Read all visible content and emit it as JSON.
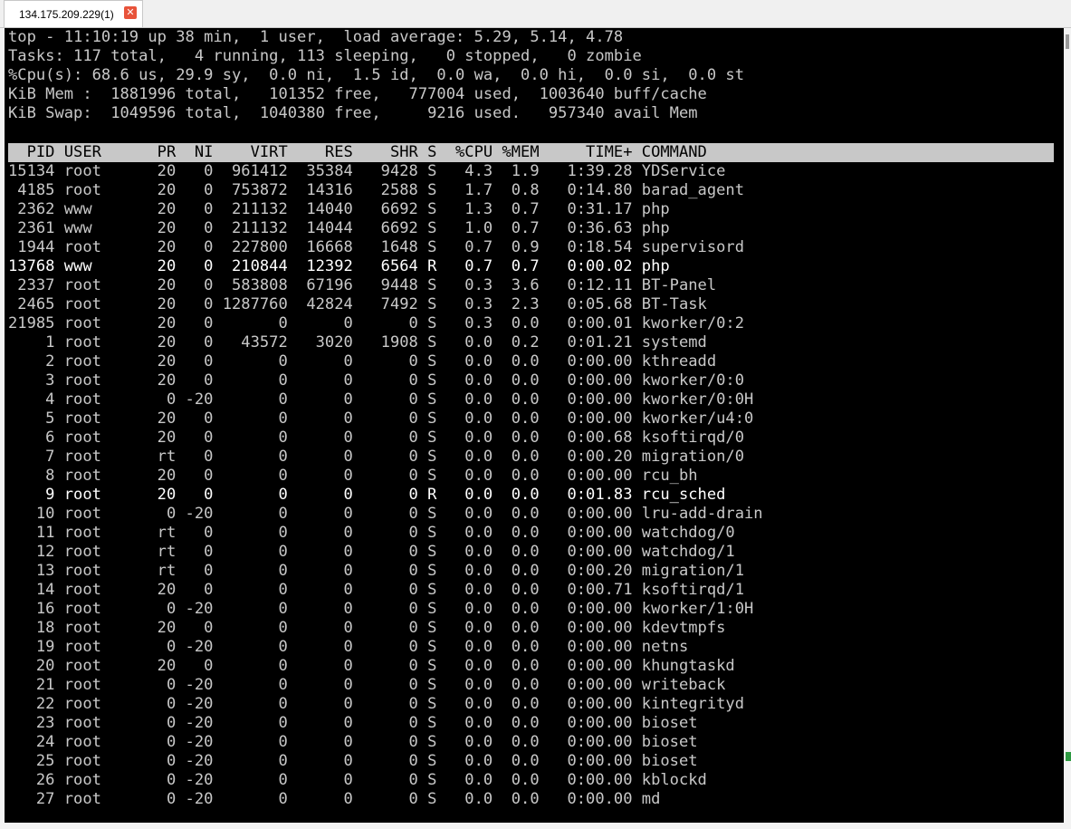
{
  "tab": {
    "title": "134.175.209.229(1)",
    "close_glyph": "✕"
  },
  "summary": [
    "top - 11:10:19 up 38 min,  1 user,  load average: 5.29, 5.14, 4.78",
    "Tasks: 117 total,   4 running, 113 sleeping,   0 stopped,   0 zombie",
    "%Cpu(s): 68.6 us, 29.9 sy,  0.0 ni,  1.5 id,  0.0 wa,  0.0 hi,  0.0 si,  0.0 st",
    "KiB Mem :  1881996 total,   101352 free,   777004 used,  1003640 buff/cache",
    "KiB Swap:  1049596 total,  1040380 free,     9216 used.   957340 avail Mem"
  ],
  "columns": [
    "PID",
    "USER",
    "PR",
    "NI",
    "VIRT",
    "RES",
    "SHR",
    "S",
    "%CPU",
    "%MEM",
    "TIME+",
    "COMMAND"
  ],
  "processes": [
    {
      "pid": "15134",
      "user": "root",
      "pr": "20",
      "ni": "0",
      "virt": "961412",
      "res": "35384",
      "shr": "9428",
      "s": "S",
      "cpu": "4.3",
      "mem": "1.9",
      "time": "1:39.28",
      "cmd": "YDService",
      "hl": false
    },
    {
      "pid": "4185",
      "user": "root",
      "pr": "20",
      "ni": "0",
      "virt": "753872",
      "res": "14316",
      "shr": "2588",
      "s": "S",
      "cpu": "1.7",
      "mem": "0.8",
      "time": "0:14.80",
      "cmd": "barad_agent",
      "hl": false
    },
    {
      "pid": "2362",
      "user": "www",
      "pr": "20",
      "ni": "0",
      "virt": "211132",
      "res": "14040",
      "shr": "6692",
      "s": "S",
      "cpu": "1.3",
      "mem": "0.7",
      "time": "0:31.17",
      "cmd": "php",
      "hl": false
    },
    {
      "pid": "2361",
      "user": "www",
      "pr": "20",
      "ni": "0",
      "virt": "211132",
      "res": "14044",
      "shr": "6692",
      "s": "S",
      "cpu": "1.0",
      "mem": "0.7",
      "time": "0:36.63",
      "cmd": "php",
      "hl": false
    },
    {
      "pid": "1944",
      "user": "root",
      "pr": "20",
      "ni": "0",
      "virt": "227800",
      "res": "16668",
      "shr": "1648",
      "s": "S",
      "cpu": "0.7",
      "mem": "0.9",
      "time": "0:18.54",
      "cmd": "supervisord",
      "hl": false
    },
    {
      "pid": "13768",
      "user": "www",
      "pr": "20",
      "ni": "0",
      "virt": "210844",
      "res": "12392",
      "shr": "6564",
      "s": "R",
      "cpu": "0.7",
      "mem": "0.7",
      "time": "0:00.02",
      "cmd": "php",
      "hl": true
    },
    {
      "pid": "2337",
      "user": "root",
      "pr": "20",
      "ni": "0",
      "virt": "583808",
      "res": "67196",
      "shr": "9448",
      "s": "S",
      "cpu": "0.3",
      "mem": "3.6",
      "time": "0:12.11",
      "cmd": "BT-Panel",
      "hl": false
    },
    {
      "pid": "2465",
      "user": "root",
      "pr": "20",
      "ni": "0",
      "virt": "1287760",
      "res": "42824",
      "shr": "7492",
      "s": "S",
      "cpu": "0.3",
      "mem": "2.3",
      "time": "0:05.68",
      "cmd": "BT-Task",
      "hl": false
    },
    {
      "pid": "21985",
      "user": "root",
      "pr": "20",
      "ni": "0",
      "virt": "0",
      "res": "0",
      "shr": "0",
      "s": "S",
      "cpu": "0.3",
      "mem": "0.0",
      "time": "0:00.01",
      "cmd": "kworker/0:2",
      "hl": false
    },
    {
      "pid": "1",
      "user": "root",
      "pr": "20",
      "ni": "0",
      "virt": "43572",
      "res": "3020",
      "shr": "1908",
      "s": "S",
      "cpu": "0.0",
      "mem": "0.2",
      "time": "0:01.21",
      "cmd": "systemd",
      "hl": false
    },
    {
      "pid": "2",
      "user": "root",
      "pr": "20",
      "ni": "0",
      "virt": "0",
      "res": "0",
      "shr": "0",
      "s": "S",
      "cpu": "0.0",
      "mem": "0.0",
      "time": "0:00.00",
      "cmd": "kthreadd",
      "hl": false
    },
    {
      "pid": "3",
      "user": "root",
      "pr": "20",
      "ni": "0",
      "virt": "0",
      "res": "0",
      "shr": "0",
      "s": "S",
      "cpu": "0.0",
      "mem": "0.0",
      "time": "0:00.00",
      "cmd": "kworker/0:0",
      "hl": false
    },
    {
      "pid": "4",
      "user": "root",
      "pr": "0",
      "ni": "-20",
      "virt": "0",
      "res": "0",
      "shr": "0",
      "s": "S",
      "cpu": "0.0",
      "mem": "0.0",
      "time": "0:00.00",
      "cmd": "kworker/0:0H",
      "hl": false
    },
    {
      "pid": "5",
      "user": "root",
      "pr": "20",
      "ni": "0",
      "virt": "0",
      "res": "0",
      "shr": "0",
      "s": "S",
      "cpu": "0.0",
      "mem": "0.0",
      "time": "0:00.00",
      "cmd": "kworker/u4:0",
      "hl": false
    },
    {
      "pid": "6",
      "user": "root",
      "pr": "20",
      "ni": "0",
      "virt": "0",
      "res": "0",
      "shr": "0",
      "s": "S",
      "cpu": "0.0",
      "mem": "0.0",
      "time": "0:00.68",
      "cmd": "ksoftirqd/0",
      "hl": false
    },
    {
      "pid": "7",
      "user": "root",
      "pr": "rt",
      "ni": "0",
      "virt": "0",
      "res": "0",
      "shr": "0",
      "s": "S",
      "cpu": "0.0",
      "mem": "0.0",
      "time": "0:00.20",
      "cmd": "migration/0",
      "hl": false
    },
    {
      "pid": "8",
      "user": "root",
      "pr": "20",
      "ni": "0",
      "virt": "0",
      "res": "0",
      "shr": "0",
      "s": "S",
      "cpu": "0.0",
      "mem": "0.0",
      "time": "0:00.00",
      "cmd": "rcu_bh",
      "hl": false
    },
    {
      "pid": "9",
      "user": "root",
      "pr": "20",
      "ni": "0",
      "virt": "0",
      "res": "0",
      "shr": "0",
      "s": "R",
      "cpu": "0.0",
      "mem": "0.0",
      "time": "0:01.83",
      "cmd": "rcu_sched",
      "hl": true
    },
    {
      "pid": "10",
      "user": "root",
      "pr": "0",
      "ni": "-20",
      "virt": "0",
      "res": "0",
      "shr": "0",
      "s": "S",
      "cpu": "0.0",
      "mem": "0.0",
      "time": "0:00.00",
      "cmd": "lru-add-drain",
      "hl": false
    },
    {
      "pid": "11",
      "user": "root",
      "pr": "rt",
      "ni": "0",
      "virt": "0",
      "res": "0",
      "shr": "0",
      "s": "S",
      "cpu": "0.0",
      "mem": "0.0",
      "time": "0:00.00",
      "cmd": "watchdog/0",
      "hl": false
    },
    {
      "pid": "12",
      "user": "root",
      "pr": "rt",
      "ni": "0",
      "virt": "0",
      "res": "0",
      "shr": "0",
      "s": "S",
      "cpu": "0.0",
      "mem": "0.0",
      "time": "0:00.00",
      "cmd": "watchdog/1",
      "hl": false
    },
    {
      "pid": "13",
      "user": "root",
      "pr": "rt",
      "ni": "0",
      "virt": "0",
      "res": "0",
      "shr": "0",
      "s": "S",
      "cpu": "0.0",
      "mem": "0.0",
      "time": "0:00.20",
      "cmd": "migration/1",
      "hl": false
    },
    {
      "pid": "14",
      "user": "root",
      "pr": "20",
      "ni": "0",
      "virt": "0",
      "res": "0",
      "shr": "0",
      "s": "S",
      "cpu": "0.0",
      "mem": "0.0",
      "time": "0:00.71",
      "cmd": "ksoftirqd/1",
      "hl": false
    },
    {
      "pid": "16",
      "user": "root",
      "pr": "0",
      "ni": "-20",
      "virt": "0",
      "res": "0",
      "shr": "0",
      "s": "S",
      "cpu": "0.0",
      "mem": "0.0",
      "time": "0:00.00",
      "cmd": "kworker/1:0H",
      "hl": false
    },
    {
      "pid": "18",
      "user": "root",
      "pr": "20",
      "ni": "0",
      "virt": "0",
      "res": "0",
      "shr": "0",
      "s": "S",
      "cpu": "0.0",
      "mem": "0.0",
      "time": "0:00.00",
      "cmd": "kdevtmpfs",
      "hl": false
    },
    {
      "pid": "19",
      "user": "root",
      "pr": "0",
      "ni": "-20",
      "virt": "0",
      "res": "0",
      "shr": "0",
      "s": "S",
      "cpu": "0.0",
      "mem": "0.0",
      "time": "0:00.00",
      "cmd": "netns",
      "hl": false
    },
    {
      "pid": "20",
      "user": "root",
      "pr": "20",
      "ni": "0",
      "virt": "0",
      "res": "0",
      "shr": "0",
      "s": "S",
      "cpu": "0.0",
      "mem": "0.0",
      "time": "0:00.00",
      "cmd": "khungtaskd",
      "hl": false
    },
    {
      "pid": "21",
      "user": "root",
      "pr": "0",
      "ni": "-20",
      "virt": "0",
      "res": "0",
      "shr": "0",
      "s": "S",
      "cpu": "0.0",
      "mem": "0.0",
      "time": "0:00.00",
      "cmd": "writeback",
      "hl": false
    },
    {
      "pid": "22",
      "user": "root",
      "pr": "0",
      "ni": "-20",
      "virt": "0",
      "res": "0",
      "shr": "0",
      "s": "S",
      "cpu": "0.0",
      "mem": "0.0",
      "time": "0:00.00",
      "cmd": "kintegrityd",
      "hl": false
    },
    {
      "pid": "23",
      "user": "root",
      "pr": "0",
      "ni": "-20",
      "virt": "0",
      "res": "0",
      "shr": "0",
      "s": "S",
      "cpu": "0.0",
      "mem": "0.0",
      "time": "0:00.00",
      "cmd": "bioset",
      "hl": false
    },
    {
      "pid": "24",
      "user": "root",
      "pr": "0",
      "ni": "-20",
      "virt": "0",
      "res": "0",
      "shr": "0",
      "s": "S",
      "cpu": "0.0",
      "mem": "0.0",
      "time": "0:00.00",
      "cmd": "bioset",
      "hl": false
    },
    {
      "pid": "25",
      "user": "root",
      "pr": "0",
      "ni": "-20",
      "virt": "0",
      "res": "0",
      "shr": "0",
      "s": "S",
      "cpu": "0.0",
      "mem": "0.0",
      "time": "0:00.00",
      "cmd": "bioset",
      "hl": false
    },
    {
      "pid": "26",
      "user": "root",
      "pr": "0",
      "ni": "-20",
      "virt": "0",
      "res": "0",
      "shr": "0",
      "s": "S",
      "cpu": "0.0",
      "mem": "0.0",
      "time": "0:00.00",
      "cmd": "kblockd",
      "hl": false
    },
    {
      "pid": "27",
      "user": "root",
      "pr": "0",
      "ni": "-20",
      "virt": "0",
      "res": "0",
      "shr": "0",
      "s": "S",
      "cpu": "0.0",
      "mem": "0.0",
      "time": "0:00.00",
      "cmd": "md",
      "hl": false
    }
  ]
}
